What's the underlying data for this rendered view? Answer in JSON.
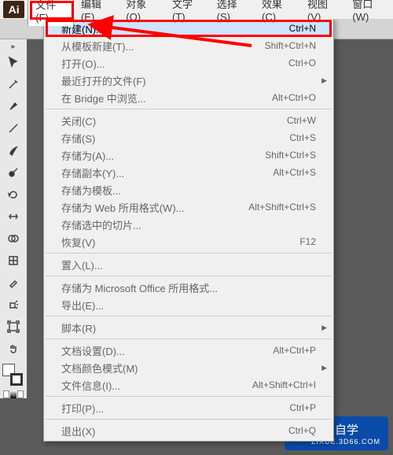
{
  "app_icon": "Ai",
  "menubar": [
    "文件(F)",
    "编辑(E)",
    "对象(O)",
    "文字(T)",
    "选择(S)",
    "效果(C)",
    "视图(V)",
    "窗口(W)"
  ],
  "dropdown": {
    "groups": [
      [
        {
          "label": "新建(N)...",
          "shortcut": "Ctrl+N",
          "highlight": true
        },
        {
          "label": "从模板新建(T)...",
          "shortcut": "Shift+Ctrl+N"
        },
        {
          "label": "打开(O)...",
          "shortcut": "Ctrl+O"
        },
        {
          "label": "最近打开的文件(F)",
          "submenu": true
        },
        {
          "label": "在 Bridge 中浏览...",
          "shortcut": "Alt+Ctrl+O"
        }
      ],
      [
        {
          "label": "关闭(C)",
          "shortcut": "Ctrl+W"
        },
        {
          "label": "存储(S)",
          "shortcut": "Ctrl+S"
        },
        {
          "label": "存储为(A)...",
          "shortcut": "Shift+Ctrl+S"
        },
        {
          "label": "存储副本(Y)...",
          "shortcut": "Alt+Ctrl+S"
        },
        {
          "label": "存储为模板..."
        },
        {
          "label": "存储为 Web 所用格式(W)...",
          "shortcut": "Alt+Shift+Ctrl+S"
        },
        {
          "label": "存储选中的切片..."
        },
        {
          "label": "恢复(V)",
          "shortcut": "F12"
        }
      ],
      [
        {
          "label": "置入(L)..."
        }
      ],
      [
        {
          "label": "存储为 Microsoft Office 所用格式..."
        },
        {
          "label": "导出(E)..."
        }
      ],
      [
        {
          "label": "脚本(R)",
          "submenu": true
        }
      ],
      [
        {
          "label": "文档设置(D)...",
          "shortcut": "Alt+Ctrl+P"
        },
        {
          "label": "文档颜色模式(M)",
          "submenu": true
        },
        {
          "label": "文件信息(I)...",
          "shortcut": "Alt+Shift+Ctrl+I"
        }
      ],
      [
        {
          "label": "打印(P)...",
          "shortcut": "Ctrl+P"
        }
      ],
      [
        {
          "label": "退出(X)",
          "shortcut": "Ctrl+Q"
        }
      ]
    ]
  },
  "watermark": {
    "text": "溜溜自学",
    "sub": "ZIXUE.3D66.COM"
  }
}
